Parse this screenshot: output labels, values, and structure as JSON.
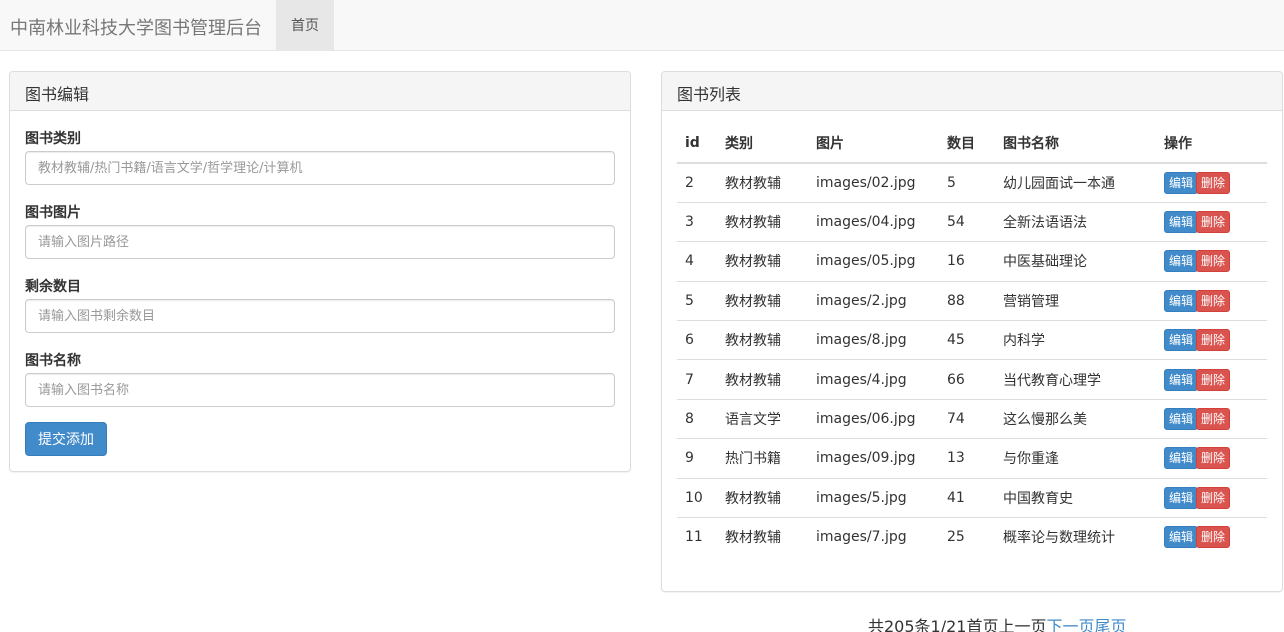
{
  "navbar": {
    "brand": "中南林业科技大学图书管理后台",
    "home": "首页"
  },
  "edit_panel": {
    "title": "图书编辑",
    "fields": [
      {
        "label": "图书类别",
        "placeholder": "教材教辅/热门书籍/语言文学/哲学理论/计算机"
      },
      {
        "label": "图书图片",
        "placeholder": "请输入图片路径"
      },
      {
        "label": "剩余数目",
        "placeholder": "请输入图书剩余数目"
      },
      {
        "label": "图书名称",
        "placeholder": "请输入图书名称"
      }
    ],
    "submit": "提交添加"
  },
  "list_panel": {
    "title": "图书列表",
    "columns": [
      "id",
      "类别",
      "图片",
      "数目",
      "图书名称",
      "操作"
    ],
    "edit_label": "编辑",
    "delete_label": "删除",
    "rows": [
      {
        "id": "2",
        "category": "教材教辅",
        "image": "images/02.jpg",
        "count": "5",
        "name": "幼儿园面试一本通"
      },
      {
        "id": "3",
        "category": "教材教辅",
        "image": "images/04.jpg",
        "count": "54",
        "name": "全新法语语法"
      },
      {
        "id": "4",
        "category": "教材教辅",
        "image": "images/05.jpg",
        "count": "16",
        "name": "中医基础理论"
      },
      {
        "id": "5",
        "category": "教材教辅",
        "image": "images/2.jpg",
        "count": "88",
        "name": "营销管理"
      },
      {
        "id": "6",
        "category": "教材教辅",
        "image": "images/8.jpg",
        "count": "45",
        "name": "内科学"
      },
      {
        "id": "7",
        "category": "教材教辅",
        "image": "images/4.jpg",
        "count": "66",
        "name": "当代教育心理学"
      },
      {
        "id": "8",
        "category": "语言文学",
        "image": "images/06.jpg",
        "count": "74",
        "name": "这么慢那么美"
      },
      {
        "id": "9",
        "category": "热门书籍",
        "image": "images/09.jpg",
        "count": "13",
        "name": "与你重逢"
      },
      {
        "id": "10",
        "category": "教材教辅",
        "image": "images/5.jpg",
        "count": "41",
        "name": "中国教育史"
      },
      {
        "id": "11",
        "category": "教材教辅",
        "image": "images/7.jpg",
        "count": "25",
        "name": "概率论与数理统计"
      }
    ]
  },
  "pager": {
    "summary": "共205条1/21",
    "first": "首页",
    "prev": "上一页",
    "next": "下一页",
    "last": "尾页"
  }
}
